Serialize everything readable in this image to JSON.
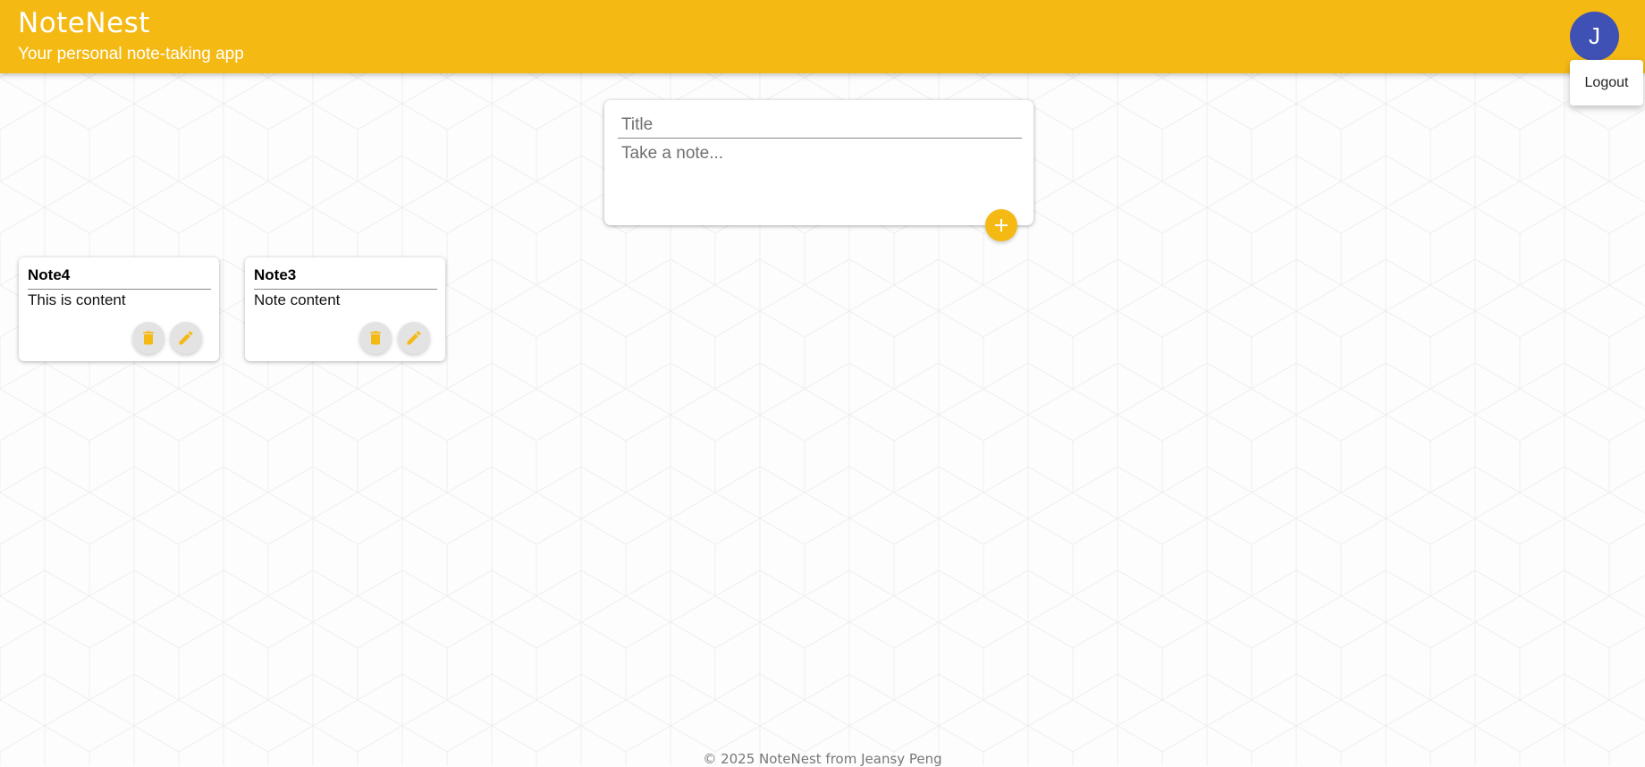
{
  "header": {
    "title": "NoteNest",
    "tagline": "Your personal note-taking app"
  },
  "user": {
    "initial": "J",
    "menu": {
      "logout_label": "Logout"
    }
  },
  "create_note": {
    "title_placeholder": "Title",
    "content_placeholder": "Take a note...",
    "title_value": "",
    "content_value": ""
  },
  "notes": [
    {
      "title": "Note4",
      "content": "This is content"
    },
    {
      "title": "Note3",
      "content": "Note content"
    }
  ],
  "footer": {
    "text": "© 2025 NoteNest from Jeansy Peng"
  },
  "colors": {
    "accent": "#f5b914",
    "avatar": "#3f51b5"
  }
}
